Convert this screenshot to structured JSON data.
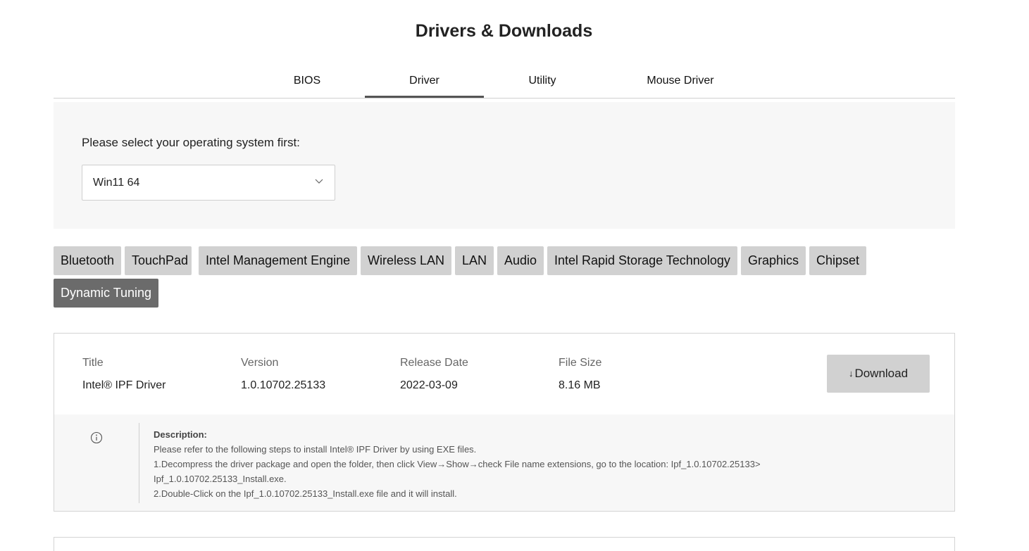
{
  "page": {
    "title": "Drivers & Downloads"
  },
  "tabs": [
    {
      "label": "BIOS",
      "active": false
    },
    {
      "label": "Driver",
      "active": true
    },
    {
      "label": "Utility",
      "active": false
    },
    {
      "label": "Mouse Driver",
      "active": false
    }
  ],
  "os_selector": {
    "label": "Please select your operating system first:",
    "selected": "Win11 64",
    "icon": "chevron-down-icon"
  },
  "categories": [
    {
      "label": "Bluetooth",
      "active": false
    },
    {
      "label": "TouchPad",
      "active": false
    },
    {
      "label": "Intel Management Engine",
      "active": false
    },
    {
      "label": "Wireless LAN",
      "active": false
    },
    {
      "label": "LAN",
      "active": false
    },
    {
      "label": "Audio",
      "active": false
    },
    {
      "label": "Intel Rapid Storage Technology",
      "active": false
    },
    {
      "label": "Graphics",
      "active": false
    },
    {
      "label": "Chipset",
      "active": false
    },
    {
      "label": "Dynamic Tuning",
      "active": true
    }
  ],
  "driver": {
    "headers": {
      "title": "Title",
      "version": "Version",
      "release_date": "Release Date",
      "file_size": "File Size"
    },
    "title": "Intel® IPF Driver",
    "version": "1.0.10702.25133",
    "release_date": "2022-03-09",
    "file_size": "8.16 MB",
    "download_label": "Download",
    "download_icon": "download-arrow-icon",
    "info_icon": "info-icon",
    "description_title": "Description:",
    "description_lines": [
      "Please refer to the following steps to install Intel® IPF Driver by using EXE files.",
      "1.Decompress the driver package and open the folder, then click View→Show→check File name extensions, go to the location: Ipf_1.0.10702.25133>",
      "Ipf_1.0.10702.25133_Install.exe.",
      "2.Double-Click on the Ipf_1.0.10702.25133_Install.exe file and it will install."
    ]
  },
  "colors": {
    "tab_active_underline": "#555555",
    "category_bg": "#d1d1d1",
    "category_active_bg": "#6b6b6b",
    "panel_bg": "#f7f7f7"
  }
}
